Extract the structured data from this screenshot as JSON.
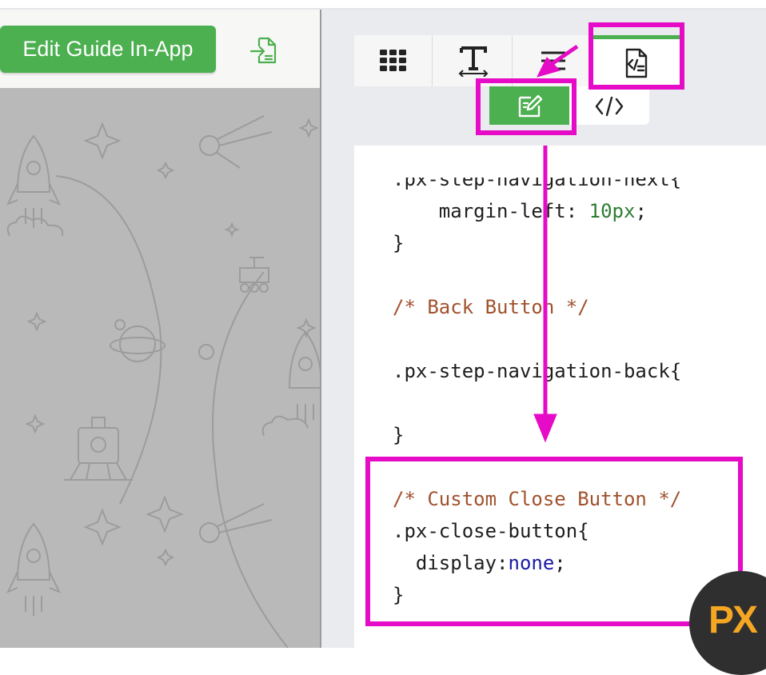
{
  "left_panel": {
    "edit_button_label": "Edit Guide In-App",
    "export_icon": "export-icon"
  },
  "toolbar": {
    "tabs": [
      {
        "icon": "grid-icon"
      },
      {
        "icon": "text-format-icon"
      },
      {
        "icon": "style-adjust-icon"
      },
      {
        "icon": "code-file-icon",
        "active": true
      }
    ],
    "subtabs": [
      {
        "icon": "edit-icon",
        "active": true
      },
      {
        "icon": "source-code-icon",
        "label": "</>"
      }
    ]
  },
  "editor": {
    "lines": [
      ".px-step-navigation-next{",
      "    margin-left: 10px;",
      "}",
      "",
      "/* Back Button */",
      "",
      ".px-step-navigation-back{",
      "",
      "}",
      "",
      "/* Custom Close Button */",
      ".px-close-button{",
      "  display:none;",
      "}"
    ]
  },
  "badge": {
    "label": "PX"
  },
  "colors": {
    "accent_green": "#4caf50",
    "annotation_magenta": "#e60bc6",
    "comment": "#a0522d",
    "number": "#2e7d32",
    "keyword": "#1a1aa6"
  }
}
